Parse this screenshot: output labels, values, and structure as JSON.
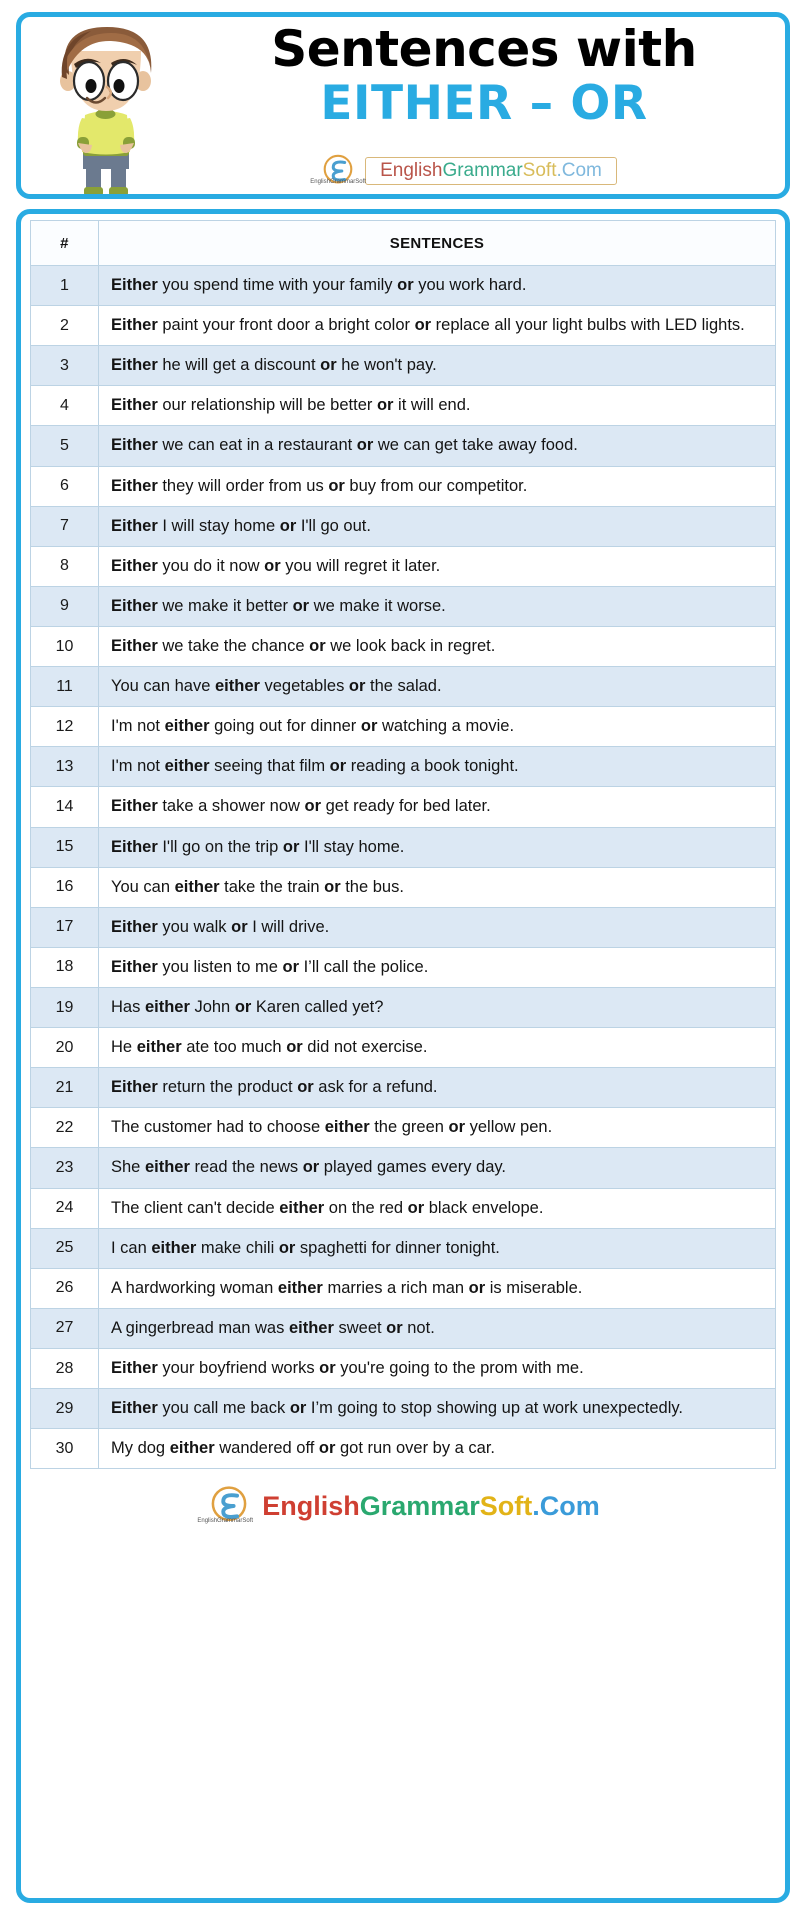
{
  "header": {
    "title_main": "Sentences with",
    "title_sub": "EITHER – OR",
    "brand": {
      "english": "English",
      "grammar": "Grammar",
      "soft": "Soft",
      "com": ".Com",
      "mark_caption": "EnglishGrammarSoft"
    }
  },
  "table": {
    "col_num": "#",
    "col_sentence": "SENTENCES",
    "rows": [
      {
        "n": "1",
        "html": "<b>Either</b> you spend time with your family <b>or</b> you work hard."
      },
      {
        "n": "2",
        "html": "<b>Either</b> paint your front door a bright color <b>or</b> replace all your light bulbs with LED lights."
      },
      {
        "n": "3",
        "html": "<b>Either</b> he will get a discount <b>or</b> he won't pay."
      },
      {
        "n": "4",
        "html": "<b>Either</b> our relationship will be better <b>or</b> it will end."
      },
      {
        "n": "5",
        "html": "<b>Either</b> we can eat in a restaurant <b>or</b> we can get take away food."
      },
      {
        "n": "6",
        "html": "<b>Either</b> they will order from us <b>or</b> buy from our competitor."
      },
      {
        "n": "7",
        "html": "<b>Either</b> I will stay home <b>or</b> I'll go out."
      },
      {
        "n": "8",
        "html": "<b>Either</b> you do it now <b>or</b> you will regret it later."
      },
      {
        "n": "9",
        "html": "<b>Either</b> we make it better <b>or</b> we make it worse."
      },
      {
        "n": "10",
        "html": "<b>Either</b> we take the chance <b>or</b> we look back in regret."
      },
      {
        "n": "11",
        "html": "You can have <b>either</b> vegetables <b>or</b> the salad."
      },
      {
        "n": "12",
        "html": "I'm not <b>either</b> going out for dinner <b>or</b> watching a movie."
      },
      {
        "n": "13",
        "html": "I'm not <b>either</b> seeing that film <b>or</b> reading a book tonight."
      },
      {
        "n": "14",
        "html": "<b>Either</b> take a shower now <b>or</b> get ready for bed later."
      },
      {
        "n": "15",
        "html": "<b>Either</b> I'll go on the trip <b>or</b> I'll stay home."
      },
      {
        "n": "16",
        "html": "You can <b>either</b> take the train <b>or</b> the bus."
      },
      {
        "n": "17",
        "html": "<b>Either</b> you walk <b>or</b> I will drive."
      },
      {
        "n": "18",
        "html": "<b>Either</b> you listen to me <b>or</b> I’ll call the police."
      },
      {
        "n": "19",
        "html": "Has <b>either</b> John <b>or</b> Karen called yet?"
      },
      {
        "n": "20",
        "html": "He <b>either</b> ate too much <b>or</b> did not exercise."
      },
      {
        "n": "21",
        "html": "<b>Either</b> return the product <b>or</b> ask for a refund."
      },
      {
        "n": "22",
        "html": "The customer had to choose <b>either</b> the green <b>or</b> yellow pen."
      },
      {
        "n": "23",
        "html": "She <b>either</b> read the news <b>or</b> played games every day."
      },
      {
        "n": "24",
        "html": "The client can't decide <b>either</b> on the red <b>or</b> black envelope."
      },
      {
        "n": "25",
        "html": "I can <b>either</b> make chili <b>or</b> spaghetti for dinner tonight."
      },
      {
        "n": "26",
        "html": "A hardworking woman <b>either</b> marries a rich man <b>or</b> is miserable."
      },
      {
        "n": "27",
        "html": "A gingerbread man was <b>either</b> sweet <b>or</b> not."
      },
      {
        "n": "28",
        "html": "<b>Either</b> your boyfriend works <b>or</b> you're going to the prom with me."
      },
      {
        "n": "29",
        "html": "<b>Either</b> you call me back <b>or</b> I’m going to stop showing up at work unexpectedly."
      },
      {
        "n": "30",
        "html": "My dog <b>either</b> wandered off <b>or</b> got run over by a car."
      }
    ]
  },
  "footer": {
    "brand": {
      "english": "English",
      "grammar": "Grammar",
      "soft": "Soft",
      "com": ".Com",
      "mark_caption": "EnglishGrammarSoft"
    }
  },
  "colors": {
    "frame_blue": "#29abe2",
    "row_alt": "#dce8f4",
    "title_sub": "#29abe2",
    "table_border": "#bcd3e4"
  }
}
